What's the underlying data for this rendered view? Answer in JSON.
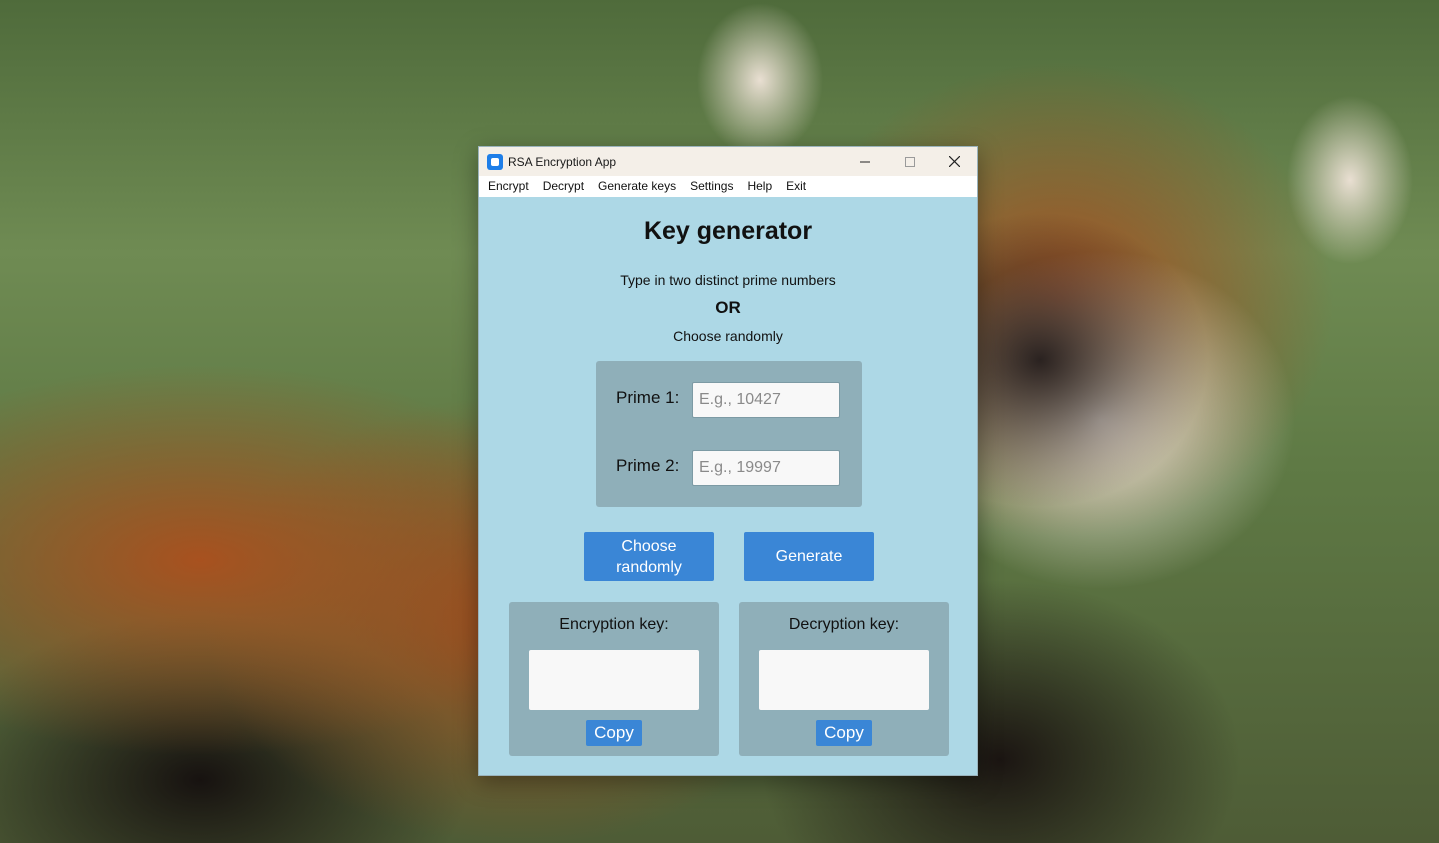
{
  "window": {
    "title": "RSA Encryption App",
    "controls": {
      "minimize": "—",
      "maximize": "□",
      "close": "✕"
    }
  },
  "menu": {
    "items": [
      "Encrypt",
      "Decrypt",
      "Generate keys",
      "Settings",
      "Help",
      "Exit"
    ]
  },
  "main": {
    "heading": "Key generator",
    "instruction_1": "Type in two distinct prime numbers",
    "instruction_or": "OR",
    "instruction_2": "Choose randomly",
    "prime1": {
      "label": "Prime 1:",
      "value": "",
      "placeholder": "E.g., 10427"
    },
    "prime2": {
      "label": "Prime 2:",
      "value": "",
      "placeholder": "E.g., 19997"
    },
    "choose_randomly_label": "Choose randomly",
    "generate_label": "Generate",
    "encryption_key": {
      "label": "Encryption key:",
      "value": "",
      "copy_label": "Copy"
    },
    "decryption_key": {
      "label": "Decryption key:",
      "value": "",
      "copy_label": "Copy"
    }
  },
  "colors": {
    "window_bg": "#add8e6",
    "panel_bg": "#8fafb9",
    "button_bg": "#3a86d6",
    "button_text": "#ffffff"
  }
}
